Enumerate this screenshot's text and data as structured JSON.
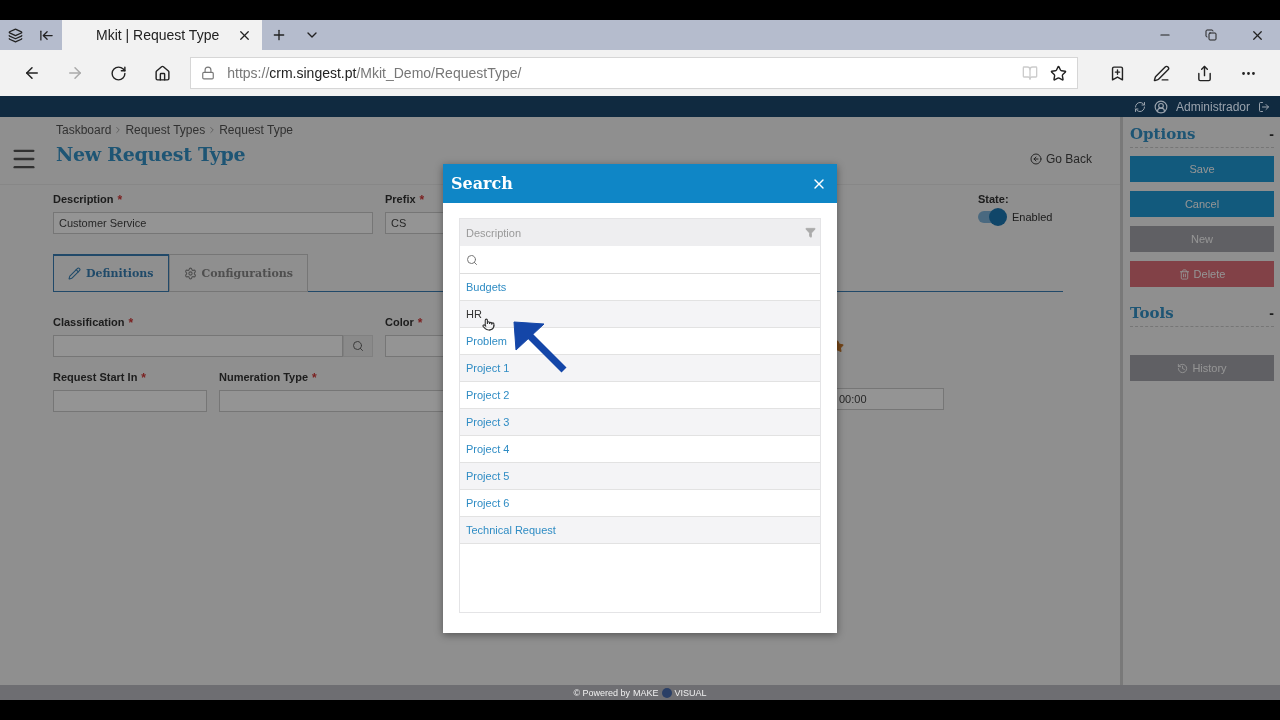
{
  "browser": {
    "tab_title": "Mkit | Request Type",
    "url_scheme": "https://",
    "url_host": "crm.singest.pt",
    "url_path": "/Mkit_Demo/RequestType/"
  },
  "app_bar": {
    "user": "Administrador"
  },
  "breadcrumb": [
    "Taskboard",
    "Request Types",
    "Request Type"
  ],
  "title": "New Request Type",
  "go_back": "Go Back",
  "form_rows": [
    [
      {
        "label": "Description",
        "required_mark": "*",
        "value": "Customer Service",
        "kind": "text"
      },
      {
        "label": "Prefix",
        "required_mark": "*",
        "value": "CS",
        "kind": "text"
      }
    ],
    [
      {
        "label": "Classification",
        "required_mark": "*",
        "kind": "lookup"
      },
      {
        "label": "Color",
        "required_mark": "*",
        "kind": "color"
      }
    ],
    [
      {
        "label": "Request Start In",
        "required_mark": "*",
        "kind": "text"
      },
      {
        "label": "Numeration Type",
        "required_mark": "*",
        "kind": "text"
      },
      {
        "value": "00:00",
        "kind": "time"
      }
    ]
  ],
  "state": {
    "label": "State:",
    "on": true,
    "text": "Enabled"
  },
  "tabs": [
    {
      "label": "Definitions",
      "selected": true
    },
    {
      "label": "Configurations",
      "selected": false
    }
  ],
  "sidebar": [
    {
      "title": "Options",
      "toggle": "-",
      "buttons": [
        {
          "label": "Save",
          "kind": "primary"
        },
        {
          "label": "Cancel",
          "kind": "primary"
        },
        {
          "label": "New",
          "kind": "disabled"
        },
        {
          "label": "Delete",
          "kind": "delete"
        }
      ]
    },
    {
      "title": "Tools",
      "toggle": "-",
      "buttons": [
        {
          "label": "History",
          "kind": "history"
        }
      ]
    }
  ],
  "modal": {
    "title": "Search",
    "column": "Description",
    "rows": [
      {
        "label": "Budgets",
        "selected": false
      },
      {
        "label": "HR",
        "selected": true
      },
      {
        "label": "Problem",
        "selected": false
      },
      {
        "label": "Project 1",
        "selected": false
      },
      {
        "label": "Project 2",
        "selected": false
      },
      {
        "label": "Project 3",
        "selected": false
      },
      {
        "label": "Project 4",
        "selected": false
      },
      {
        "label": "Project 5",
        "selected": false
      },
      {
        "label": "Project 6",
        "selected": false
      },
      {
        "label": "Technical Request",
        "selected": false
      }
    ]
  },
  "footer": {
    "powered_by": "© Powered by",
    "brand_left": "MAKE",
    "brand_right": "VISUAL"
  }
}
